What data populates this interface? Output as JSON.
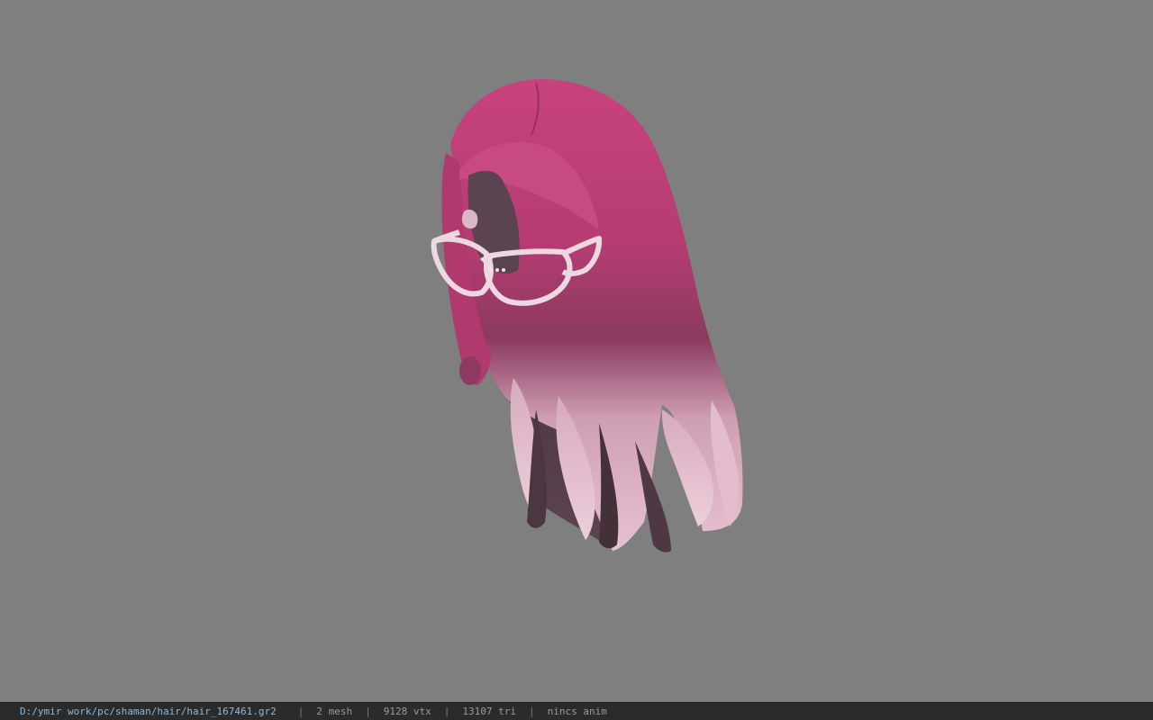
{
  "viewer": {
    "background": "#7f7f7f",
    "model_name": "hair_167461"
  },
  "statusbar": {
    "path": "D:/ymir work/pc/shaman/hair/hair_167461.gr2",
    "separator": "|",
    "mesh": "2 mesh",
    "vertices": "9128 vtx",
    "triangles": "13107 tri",
    "anim": "nincs anim"
  },
  "colors": {
    "hair_top": "#c8437e",
    "hair_mid": "#b0396e",
    "hair_dark": "#4a3540",
    "hair_tips": "#e0b8c8",
    "glasses": "#ecd8e0"
  }
}
